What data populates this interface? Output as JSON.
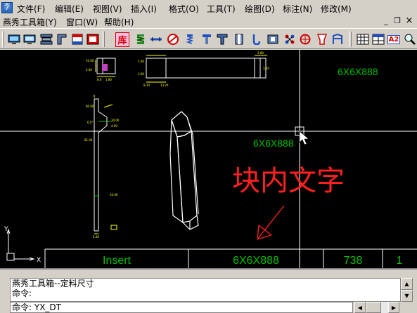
{
  "app_icon": "李",
  "menu_row1": [
    "文件(F)",
    "编辑(E)",
    "视图(V)",
    "插入(I)",
    "格式(O)",
    "工具(T)",
    "绘图(D)",
    "标注(N)",
    "修改(M)"
  ],
  "menu_row2": [
    "燕秀工具箱(Y)",
    "窗口(W)",
    "帮助(H)"
  ],
  "window_controls": {
    "minimize": "_",
    "restore": "❐",
    "close": "×"
  },
  "toolbar": {
    "library_label": "库",
    "text_a2_label": "A2",
    "icons": [
      "monitor-icon",
      "monitor-icon",
      "die-icon",
      "slider-icon",
      "border-icon",
      "frame-icon",
      "library-icon",
      "spring-icon",
      "pin-icon",
      "sprue-icon",
      "screw-icon",
      "bolt-icon",
      "ejector-icon",
      "bushing-icon",
      "hook-icon",
      "block-icon",
      "cooling-icon",
      "wheel-icon",
      "crosshair-icon",
      "cup-icon",
      "leg-icon",
      "grid-icon",
      "table-icon",
      "text-icon",
      "zoom-icon"
    ]
  },
  "canvas": {
    "block_text_top": "6X6X888",
    "block_text_mid": "6X6X888",
    "annotation": "块内文字",
    "ucs_y": "Y",
    "ucs_x": "X",
    "table_insert": "Insert",
    "table_size": "6X6X888",
    "table_num": "738",
    "table_qty": "1"
  },
  "command": {
    "history": [
      "燕秀工具箱--定料尺寸",
      "命令:"
    ],
    "prompt": "命令: YX_DT"
  }
}
